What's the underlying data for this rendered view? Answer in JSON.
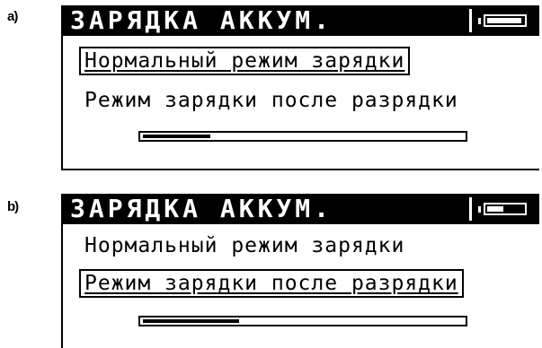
{
  "panels": [
    {
      "tag": "a)",
      "title": "ЗАРЯДКА АККУМ.",
      "options": [
        {
          "label": "Нормальный режим зарядки",
          "selected": true
        },
        {
          "label": "Режим зарядки после разрядки",
          "selected": false
        }
      ],
      "battery_level": 0.95,
      "progress": 0.21
    },
    {
      "tag": "b)",
      "title": "ЗАРЯДКА АККУМ.",
      "options": [
        {
          "label": "Нормальный режим зарядки",
          "selected": false
        },
        {
          "label": "Режим зарядки после разрядки",
          "selected": true
        }
      ],
      "battery_level": 0.45,
      "progress": 0.3
    }
  ]
}
